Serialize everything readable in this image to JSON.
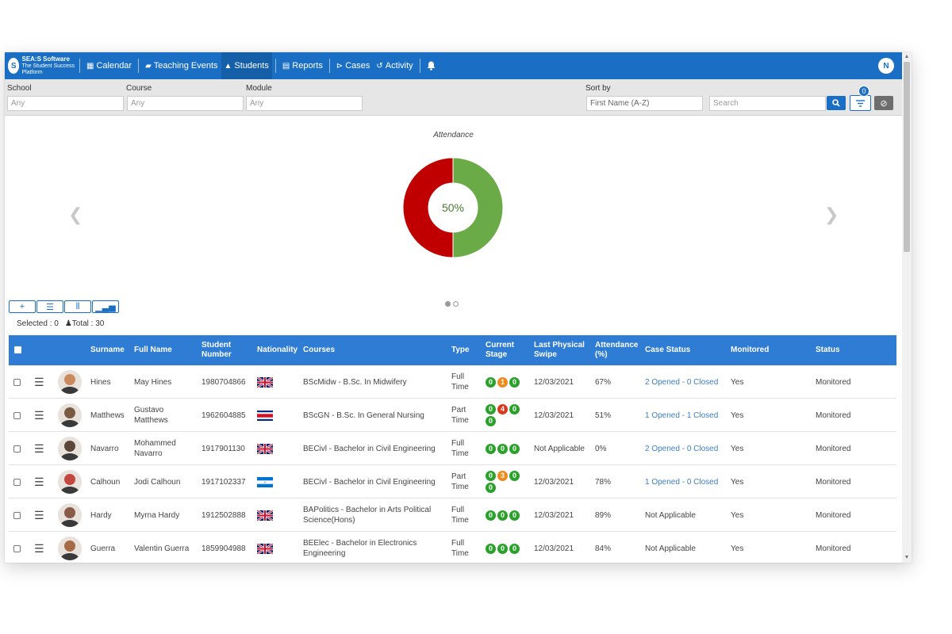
{
  "nav": {
    "brand_name": "SEA:S Software",
    "brand_tagline": "The Student Success Platform",
    "items": [
      {
        "label": "Calendar",
        "icon": "calendar-icon"
      },
      {
        "label": "Teaching Events",
        "icon": "book-icon"
      },
      {
        "label": "Students",
        "icon": "graduation-cap-icon",
        "active": true
      },
      {
        "label": "Reports",
        "icon": "file-icon"
      },
      {
        "label": "Cases",
        "icon": "cases-icon"
      },
      {
        "label": "Activity",
        "icon": "history-icon"
      }
    ],
    "user_initial": "N"
  },
  "filters": {
    "school_label": "School",
    "school_placeholder": "Any",
    "course_label": "Course",
    "course_placeholder": "Any",
    "module_label": "Module",
    "module_placeholder": "Any",
    "sortby_label": "Sort by",
    "sortby_value": "First Name (A-Z)",
    "search_placeholder": "Search",
    "filter_count": "0"
  },
  "chart_data": {
    "type": "pie",
    "title": "Attendance",
    "center_label": "50%",
    "slices": [
      {
        "label": "",
        "value": 50,
        "color": "#6aab48"
      },
      {
        "label": "",
        "value": 50,
        "color": "#c00000"
      }
    ]
  },
  "toolbar": {
    "selected_label": "Selected : 0",
    "total_label": "Total : 30"
  },
  "table": {
    "headers": {
      "surname": "Surname",
      "full_name": "Full Name",
      "student_number": "Student Number",
      "nationality": "Nationality",
      "courses": "Courses",
      "type": "Type",
      "current_stage": "Current Stage",
      "last_swipe": "Last Physical Swipe",
      "attendance": "Attendance (%)",
      "case_status": "Case Status",
      "monitored": "Monitored",
      "status": "Status"
    },
    "rows": [
      {
        "surname": "Hines",
        "full_name": "May Hines",
        "student_number": "1980704866",
        "flag": "uk",
        "course": "BScMidw - B.Sc. In Midwifery",
        "type": "Full Time",
        "stages": [
          [
            "0",
            "g"
          ],
          [
            "1",
            "o"
          ],
          [
            "0",
            "g"
          ]
        ],
        "swipe": "12/03/2021",
        "attendance": "67%",
        "case_status": "2 Opened - 0 Closed",
        "case_link": true,
        "monitored": "Yes",
        "status": "Monitored",
        "photo": "#c98a5e"
      },
      {
        "surname": "Matthews",
        "full_name": "Gustavo Matthews",
        "student_number": "1962604885",
        "flag": "cr",
        "course": "BScGN - B.Sc. In General Nursing",
        "type": "Part Time",
        "stages": [
          [
            "0",
            "g"
          ],
          [
            "4",
            "r"
          ],
          [
            "0",
            "g"
          ],
          [
            "0",
            "g"
          ]
        ],
        "swipe": "12/03/2021",
        "attendance": "51%",
        "case_status": "1 Opened - 1 Closed",
        "case_link": true,
        "monitored": "Yes",
        "status": "Monitored",
        "photo": "#7a5a43"
      },
      {
        "surname": "Navarro",
        "full_name": "Mohammed Navarro",
        "student_number": "1917901130",
        "flag": "uk",
        "course": "BECivl - Bachelor in Civil Engineering",
        "type": "Full Time",
        "stages": [
          [
            "0",
            "g"
          ],
          [
            "0",
            "g"
          ],
          [
            "0",
            "g"
          ]
        ],
        "swipe": "Not Applicable",
        "attendance": "0%",
        "case_status": "2 Opened - 0 Closed",
        "case_link": true,
        "monitored": "Yes",
        "status": "Monitored",
        "photo": "#5b4637"
      },
      {
        "surname": "Calhoun",
        "full_name": "Jodi Calhoun",
        "student_number": "1917102337",
        "flag": "hn",
        "course": "BECivl - Bachelor in Civil Engineering",
        "type": "Part Time",
        "stages": [
          [
            "0",
            "g"
          ],
          [
            "3",
            "o"
          ],
          [
            "0",
            "g"
          ],
          [
            "0",
            "g"
          ]
        ],
        "swipe": "12/03/2021",
        "attendance": "78%",
        "case_status": "1 Opened - 0 Closed",
        "case_link": true,
        "monitored": "Yes",
        "status": "Monitored",
        "photo": "#c2473f"
      },
      {
        "surname": "Hardy",
        "full_name": "Myrna Hardy",
        "student_number": "1912502888",
        "flag": "uk",
        "course": "BAPolitics - Bachelor in Arts Political Science(Hons)",
        "type": "Full Time",
        "stages": [
          [
            "0",
            "g"
          ],
          [
            "0",
            "g"
          ],
          [
            "0",
            "g"
          ]
        ],
        "swipe": "12/03/2021",
        "attendance": "89%",
        "case_status": "Not Applicable",
        "case_link": false,
        "monitored": "Yes",
        "status": "Monitored",
        "photo": "#8a5a48"
      },
      {
        "surname": "Guerra",
        "full_name": "Valentin Guerra",
        "student_number": "1859904988",
        "flag": "uk",
        "course": "BEElec - Bachelor in Electronics Engineering",
        "type": "Full Time",
        "stages": [
          [
            "0",
            "g"
          ],
          [
            "0",
            "g"
          ],
          [
            "0",
            "g"
          ]
        ],
        "swipe": "12/03/2021",
        "attendance": "84%",
        "case_status": "Not Applicable",
        "case_link": false,
        "monitored": "Yes",
        "status": "Monitored",
        "photo": "#a56b45"
      }
    ]
  }
}
